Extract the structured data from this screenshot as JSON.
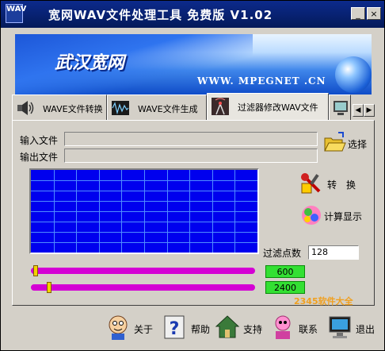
{
  "window": {
    "title": "宽网WAV文件处理工具 免费版 V1.02",
    "icon_text": "WAV",
    "minimize_glyph": "_",
    "close_glyph": "×"
  },
  "banner": {
    "brand": "武汉宽网",
    "url": "WWW. MPEGNET .CN"
  },
  "tabs": [
    {
      "label": "WAVE文件转换",
      "icon": "speaker-icon"
    },
    {
      "label": "WAVE文件生成",
      "icon": "wave-generate-icon"
    },
    {
      "label": "过滤器修改WAV文件",
      "icon": "antenna-filter-icon"
    }
  ],
  "tab_spin": {
    "left": "◀",
    "right": "▶"
  },
  "form": {
    "input_label": "输入文件",
    "output_label": "输出文件",
    "input_value": "",
    "output_value": "",
    "select_label": "选择"
  },
  "actions": {
    "convert_label": "转　换",
    "calc_label": "计算显示"
  },
  "filter": {
    "points_label": "过滤点数",
    "points_value": "128"
  },
  "sliders": [
    {
      "value": "600",
      "position": 0.01
    },
    {
      "value": "2400",
      "position": 0.07
    }
  ],
  "bottom": [
    {
      "label": "关于",
      "icon": "cartoon-face-icon"
    },
    {
      "label": "帮助",
      "icon": "help-book-icon"
    },
    {
      "label": "支持",
      "icon": "house-support-icon"
    },
    {
      "label": "联系",
      "icon": "contact-icon"
    },
    {
      "label": "退出",
      "icon": "monitor-exit-icon"
    }
  ],
  "watermark": "2345软件大全",
  "colors": {
    "title_bar": "#0a246a",
    "grid_bg": "#0000ee",
    "grid_lines": "#4f8cff",
    "slider": "#d400d4",
    "value_box": "#33e033"
  }
}
